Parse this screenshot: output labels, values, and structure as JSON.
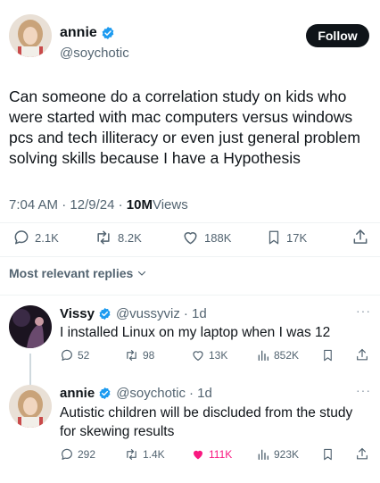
{
  "main_tweet": {
    "author_name": "annie",
    "author_handle": "@soychotic",
    "follow_label": "Follow",
    "text": "Can someone do a correlation study on kids who were started with mac computers versus windows pcs and tech illiteracy or even just general problem solving skills because I have a Hypothesis",
    "time": "7:04 AM",
    "date": "12/9/24",
    "sep": " · ",
    "views_count": "10M",
    "views_label": " Views",
    "replies": "2.1K",
    "retweets": "8.2K",
    "likes": "188K",
    "bookmarks": "17K"
  },
  "replies_header": "Most relevant replies",
  "replies": [
    {
      "author_name": "Vissy",
      "author_handle": "@vussyviz",
      "time": "· 1d",
      "text": "I installed Linux on my laptop when I was 12",
      "replies": "52",
      "retweets": "98",
      "likes": "13K",
      "views": "852K",
      "liked": false
    },
    {
      "author_name": "annie",
      "author_handle": "@soychotic",
      "time": "· 1d",
      "text": "Autistic children will be discluded from the study for skewing results",
      "replies": "292",
      "retweets": "1.4K",
      "likes": "111K",
      "views": "923K",
      "liked": true
    }
  ],
  "icons": {
    "verified": "verified-badge-icon",
    "reply": "reply-icon",
    "retweet": "retweet-icon",
    "like": "heart-icon",
    "views": "views-chart-icon",
    "bookmark": "bookmark-icon",
    "share": "share-icon",
    "more": "more-icon",
    "chevron": "chevron-down-icon"
  },
  "colors": {
    "verified_blue": "#1d9bf0",
    "like_pink": "#f91880",
    "text_primary": "#0f1419",
    "text_secondary": "#536471"
  }
}
